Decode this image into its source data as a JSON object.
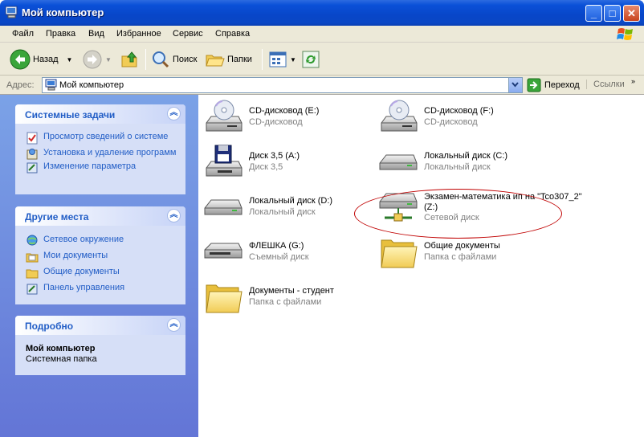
{
  "window": {
    "title": "Мой компьютер",
    "min_label": "_",
    "max_label": "□",
    "close_label": "✕"
  },
  "menu": [
    "Файл",
    "Правка",
    "Вид",
    "Избранное",
    "Сервис",
    "Справка"
  ],
  "toolbar": {
    "back_label": "Назад",
    "search_label": "Поиск",
    "folders_label": "Папки"
  },
  "address": {
    "label": "Адрес:",
    "value": "Мой компьютер",
    "go_label": "Переход",
    "links_label": "Ссылки"
  },
  "panels": {
    "system_tasks": {
      "title": "Системные задачи",
      "items": [
        "Просмотр сведений о системе",
        "Установка и удаление программ",
        "Изменение параметра"
      ]
    },
    "other_places": {
      "title": "Другие места",
      "items": [
        "Сетевое окружение",
        "Мои документы",
        "Общие документы",
        "Панель управления"
      ]
    },
    "details": {
      "title": "Подробно",
      "name": "Мой компьютер",
      "type": "Системная папка"
    }
  },
  "items": [
    {
      "name": "CD-дисковод (E:)",
      "type": "CD-дисковод",
      "icon": "cd-drive-icon"
    },
    {
      "name": "CD-дисковод (F:)",
      "type": "CD-дисковод",
      "icon": "cd-drive-icon"
    },
    {
      "name": "Диск 3,5 (A:)",
      "type": "Диск 3,5",
      "icon": "floppy-drive-icon"
    },
    {
      "name": "Локальный диск (C:)",
      "type": "Локальный диск",
      "icon": "hard-drive-icon"
    },
    {
      "name": "Локальный диск (D:)",
      "type": "Локальный диск",
      "icon": "hard-drive-icon"
    },
    {
      "name": "Экзамен-математика ип на \"Tco307_2\" (Z:)",
      "type": "Сетевой диск",
      "icon": "network-drive-icon"
    },
    {
      "name": "ФЛЕШКА (G:)",
      "type": "Съемный диск",
      "icon": "removable-drive-icon"
    },
    {
      "name": "Общие документы",
      "type": "Папка с файлами",
      "icon": "folder-icon"
    },
    {
      "name": "Документы - студент",
      "type": "Папка с файлами",
      "icon": "folder-icon"
    }
  ],
  "colors": {
    "titlebar": "#0a50d8",
    "task_link": "#215dc6",
    "panel_bg": "#d6dff7",
    "highlight": "#c00000"
  }
}
